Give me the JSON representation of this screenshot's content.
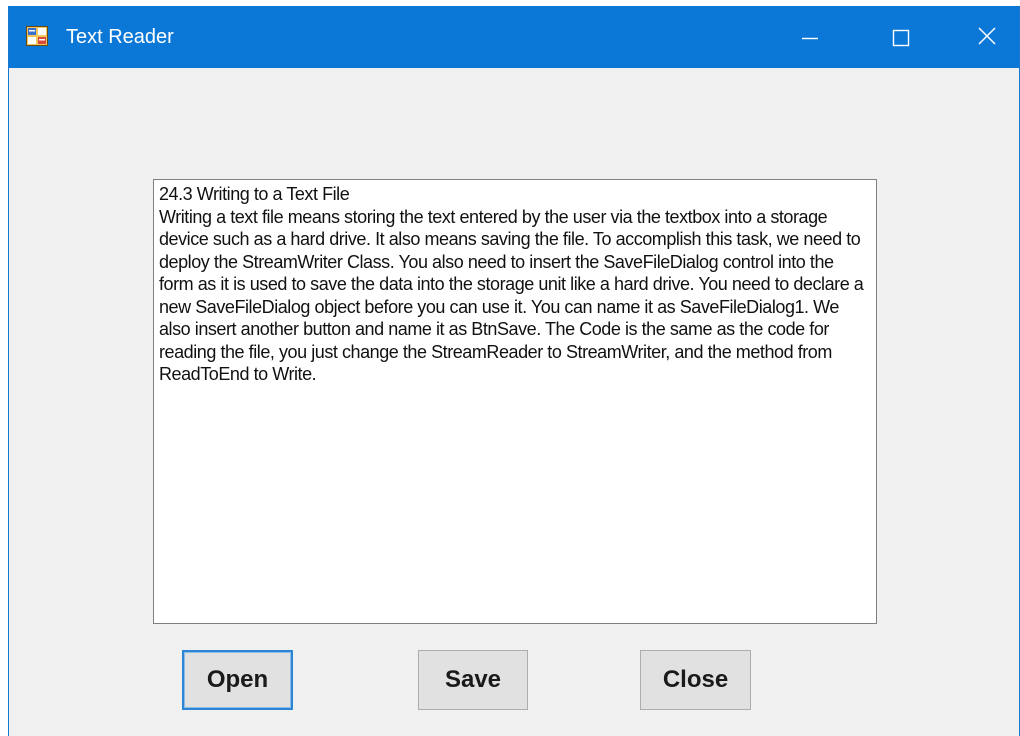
{
  "window": {
    "title": "Text Reader",
    "app_icon": "form-app-icon",
    "controls": {
      "minimize_icon": "minimize-icon",
      "maximize_icon": "maximize-icon",
      "close_icon": "close-icon"
    },
    "titlebar_color": "#0b78d7"
  },
  "textbox": {
    "content": "24.3 Writing to a Text File\nWriting a text file means storing the text entered by the user via the textbox into a storage device such as a hard drive. It also means saving the file. To accomplish this task, we need to deploy the StreamWriter Class. You also need to insert the SaveFileDialog control into the form as it is used to save the data into the storage unit like a hard drive. You need to declare a new SaveFileDialog object before you can use it. You can name it as SaveFileDialog1. We also insert another button and name it as BtnSave. The Code is the same as the code for reading the file, you just change the StreamReader to StreamWriter, and the method from ReadToEnd to Write."
  },
  "buttons": {
    "open_label": "Open",
    "save_label": "Save",
    "close_label": "Close"
  }
}
